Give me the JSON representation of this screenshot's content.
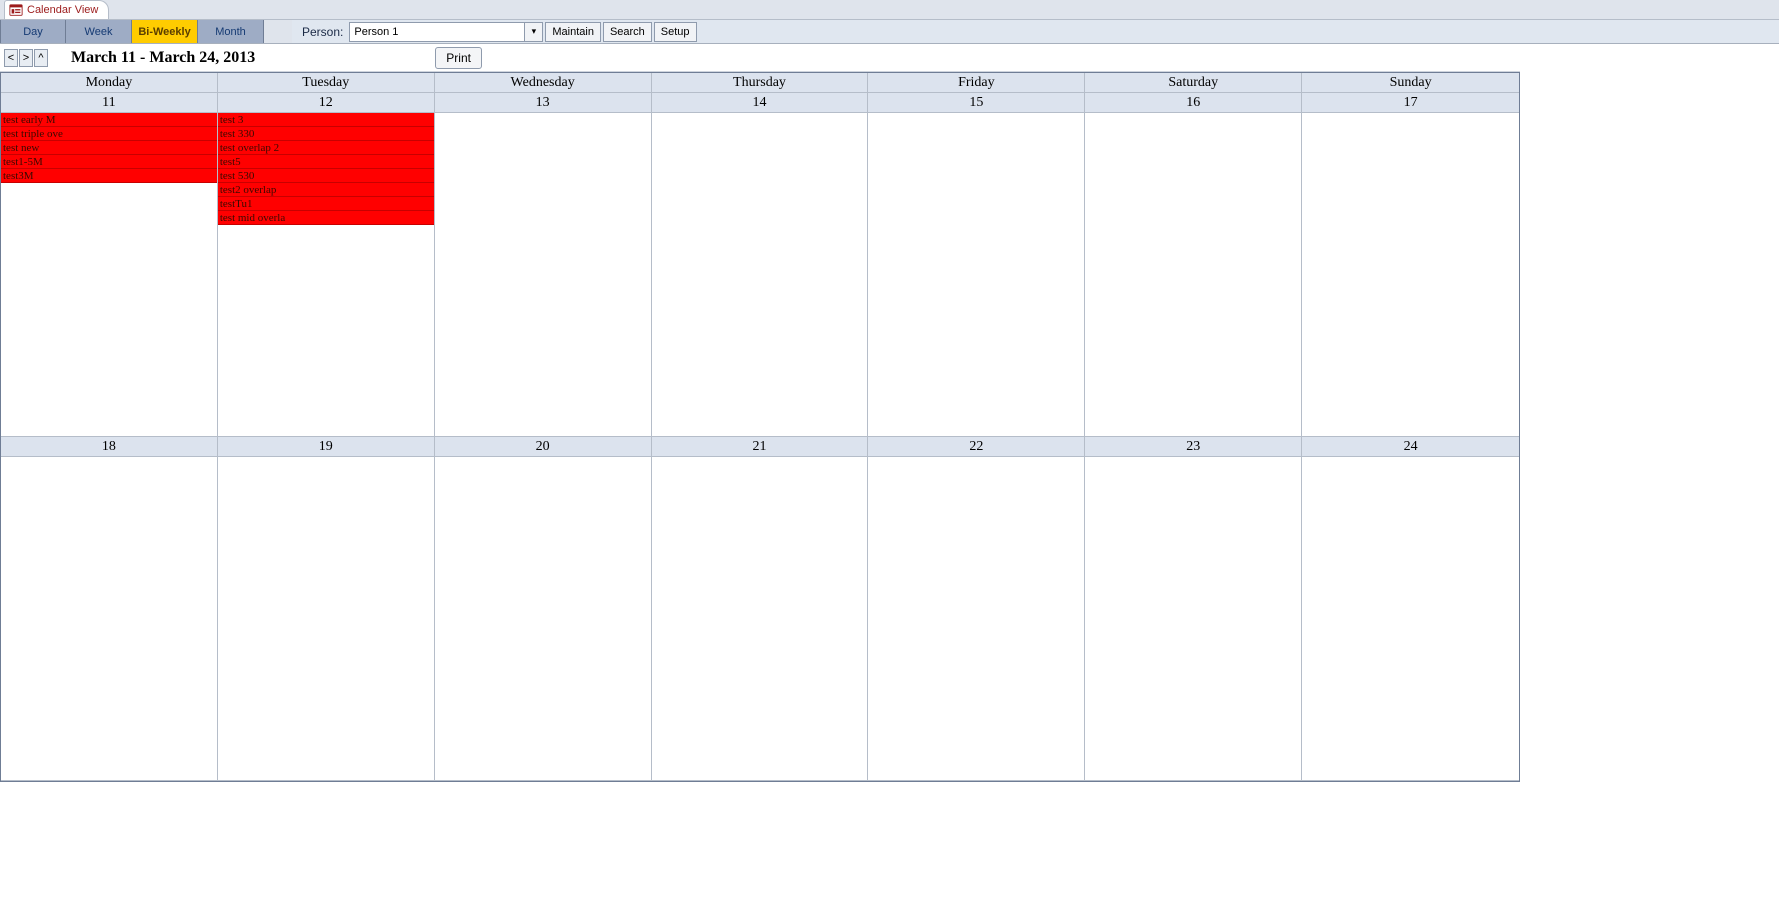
{
  "tab": {
    "title": "Calendar View"
  },
  "views": {
    "items": [
      {
        "label": "Day",
        "active": false
      },
      {
        "label": "Week",
        "active": false
      },
      {
        "label": "Bi-Weekly",
        "active": true
      },
      {
        "label": "Month",
        "active": false
      }
    ]
  },
  "person": {
    "label": "Person:",
    "value": "Person 1"
  },
  "toolbar_buttons": {
    "maintain": "Maintain",
    "search": "Search",
    "setup": "Setup"
  },
  "nav": {
    "prev": "<",
    "next": ">",
    "up": "^",
    "range_title": "March 11 - March 24, 2013",
    "print": "Print"
  },
  "day_names": [
    "Monday",
    "Tuesday",
    "Wednesday",
    "Thursday",
    "Friday",
    "Saturday",
    "Sunday"
  ],
  "week1_dates": [
    "11",
    "12",
    "13",
    "14",
    "15",
    "16",
    "17"
  ],
  "week2_dates": [
    "18",
    "19",
    "20",
    "21",
    "22",
    "23",
    "24"
  ],
  "events": {
    "w1d0": [
      "test early M",
      "test triple ove",
      "test new",
      "test1-5M",
      "test3M"
    ],
    "w1d1": [
      "test 3",
      "test 330",
      "test overlap 2",
      "test5",
      "test 530",
      "test2 overlap",
      "testTu1",
      "test mid overla"
    ]
  }
}
